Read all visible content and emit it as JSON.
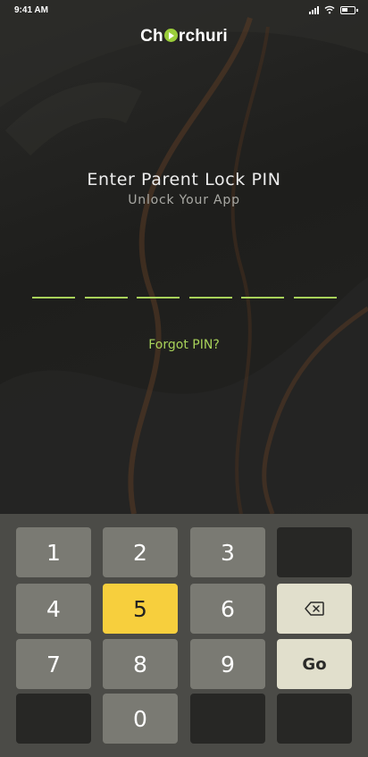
{
  "status_bar": {
    "time": "9:41 AM"
  },
  "brand": {
    "prefix": "Ch",
    "suffix": "rchuri",
    "accent": "#9acd3a"
  },
  "header": {
    "title": "Enter Parent Lock PIN",
    "subtitle": "Unlock Your App"
  },
  "pin": {
    "length": 6,
    "filled": 0
  },
  "forgot_link": "Forgot PIN?",
  "keypad": {
    "keys": {
      "k1": "1",
      "k2": "2",
      "k3": "3",
      "k4": "4",
      "k5": "5",
      "k6": "6",
      "k7": "7",
      "k8": "8",
      "k9": "9",
      "k0": "0",
      "go": "Go"
    },
    "highlighted_key": "5",
    "backspace_icon": "backspace-icon"
  },
  "colors": {
    "pin_underline": "#a8d25a",
    "highlight": "#f7cf3d",
    "action_key": "#e1dfcc"
  }
}
